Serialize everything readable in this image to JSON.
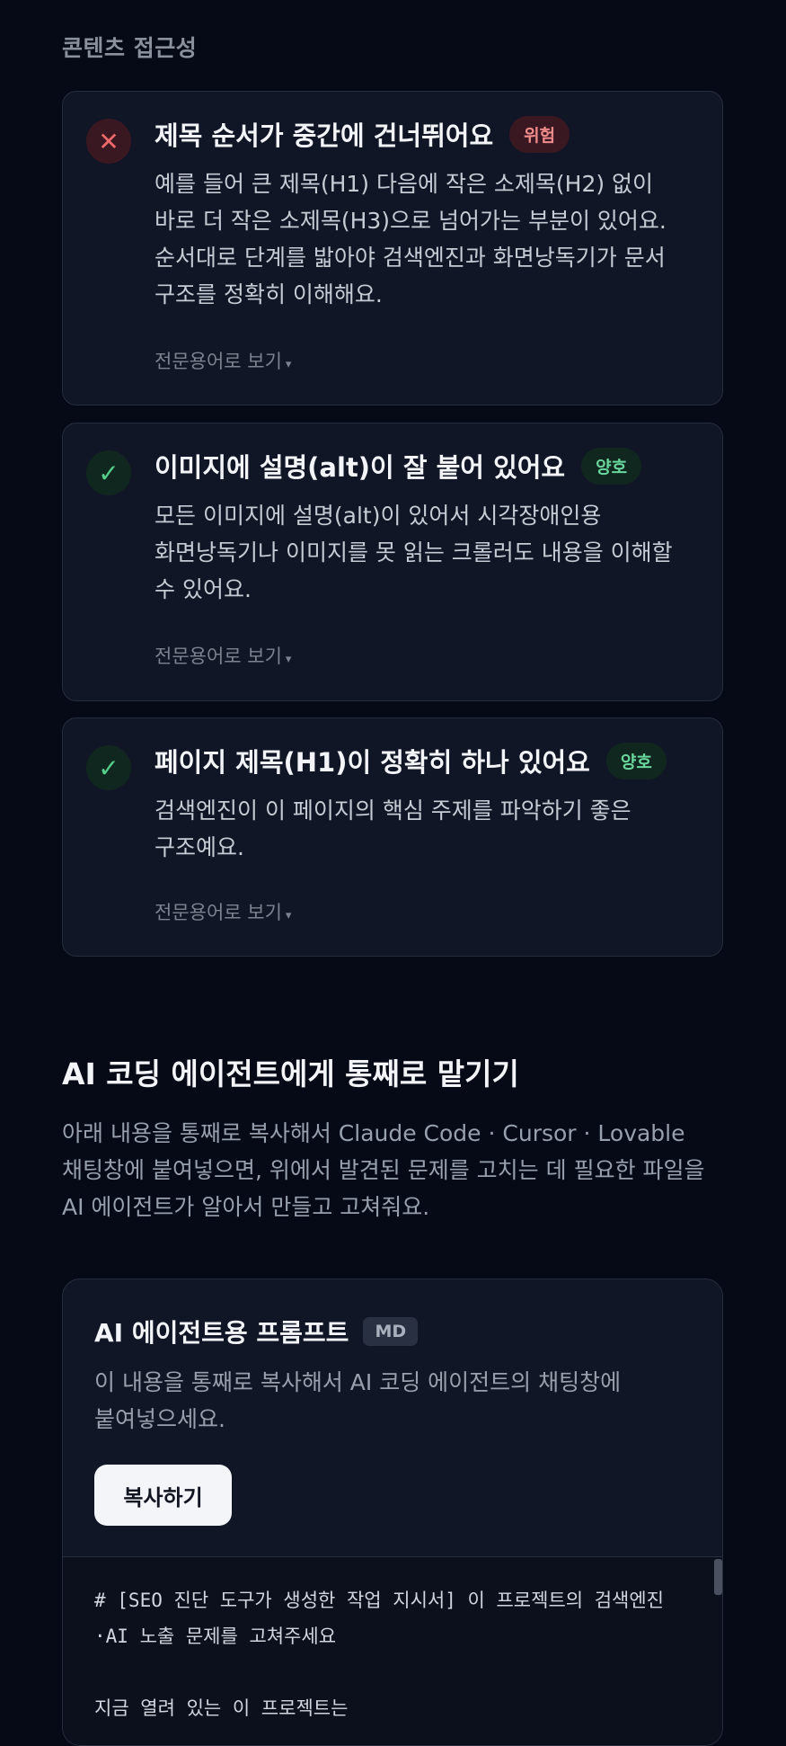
{
  "section_label": "콘텐츠 접근성",
  "cards": [
    {
      "status": "bad",
      "status_icon": "x-icon",
      "status_glyph": "✕",
      "title": "제목 순서가 중간에 건너뛰어요",
      "badge": "위험",
      "desc": "예를 들어 큰 제목(H1) 다음에 작은 소제목(H2) 없이 바로 더 작은 소제목(H3)으로 넘어가는 부분이 있어요. 순서대로 단계를 밟아야 검색엔진과 화면낭독기가 문서 구조를 정확히 이해해요.",
      "expand_label": "전문용어로 보기"
    },
    {
      "status": "good",
      "status_icon": "check-icon",
      "status_glyph": "✓",
      "title": "이미지에 설명(alt)이 잘 붙어 있어요",
      "badge": "양호",
      "desc": "모든 이미지에 설명(alt)이 있어서 시각장애인용 화면낭독기나 이미지를 못 읽는 크롤러도 내용을 이해할 수 있어요.",
      "expand_label": "전문용어로 보기"
    },
    {
      "status": "good",
      "status_icon": "check-icon",
      "status_glyph": "✓",
      "title": "페이지 제목(H1)이 정확히 하나 있어요",
      "badge": "양호",
      "desc": "검색엔진이 이 페이지의 핵심 주제를 파악하기 좋은 구조예요.",
      "expand_label": "전문용어로 보기"
    }
  ],
  "expand_caret": "▾",
  "ai_section": {
    "heading": "AI 코딩 에이전트에게 통째로 맡기기",
    "desc": "아래 내용을 통째로 복사해서 Claude Code · Cursor · Lovable 채팅창에 붙여넣으면, 위에서 발견된 문제를 고치는 데 필요한 파일을 AI 에이전트가 알아서 만들고 고쳐줘요."
  },
  "prompt_card": {
    "title": "AI 에이전트용 프롬프트",
    "badge": "MD",
    "desc": "이 내용을 통째로 복사해서 AI 코딩 에이전트의 채팅창에 붙여넣으세요.",
    "copy_label": "복사하기",
    "code": "# [SEO 진단 도구가 생성한 작업 지시서] 이 프로젝트의 검색엔진·AI 노출 문제를 고쳐주세요\n\n지금 열려 있는 이 프로젝트는"
  }
}
